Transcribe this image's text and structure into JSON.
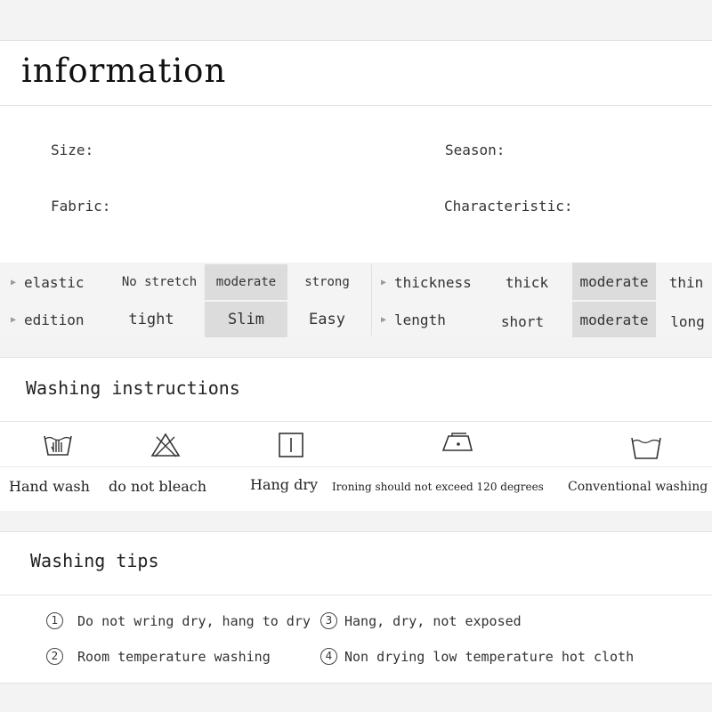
{
  "information": {
    "title": "information",
    "size_label": "Size:",
    "season_label": "Season:",
    "fabric_label": "Fabric:",
    "characteristic_label": "Characteristic:"
  },
  "attributes": {
    "elastic": {
      "label": "elastic",
      "options": [
        "No stretch",
        "moderate",
        "strong"
      ],
      "selected": "moderate"
    },
    "thickness": {
      "label": "thickness",
      "options": [
        "thick",
        "moderate",
        "thin"
      ],
      "selected": "moderate"
    },
    "edition": {
      "label": "edition",
      "options": [
        "tight",
        "Slim",
        "Easy"
      ],
      "selected": "Slim"
    },
    "length": {
      "label": "length",
      "options": [
        "short",
        "moderate",
        "long"
      ],
      "selected": "moderate"
    }
  },
  "washing": {
    "title": "Washing instructions",
    "items": [
      {
        "icon": "hand-wash-icon",
        "label": "Hand wash"
      },
      {
        "icon": "no-bleach-icon",
        "label": "do not bleach"
      },
      {
        "icon": "hang-dry-icon",
        "label": "Hang dry"
      },
      {
        "icon": "iron-icon",
        "label": "Ironing should not exceed 120 degrees"
      },
      {
        "icon": "machine-wash-icon",
        "label": "Conventional washing"
      }
    ]
  },
  "tips": {
    "title": "Washing tips",
    "items": [
      {
        "num": "1",
        "text": "Do not wring dry, hang to dry"
      },
      {
        "num": "3",
        "text": "Hang, dry, not exposed"
      },
      {
        "num": "2",
        "text": "Room temperature washing"
      },
      {
        "num": "4",
        "text": "Non drying low temperature hot cloth"
      }
    ]
  }
}
